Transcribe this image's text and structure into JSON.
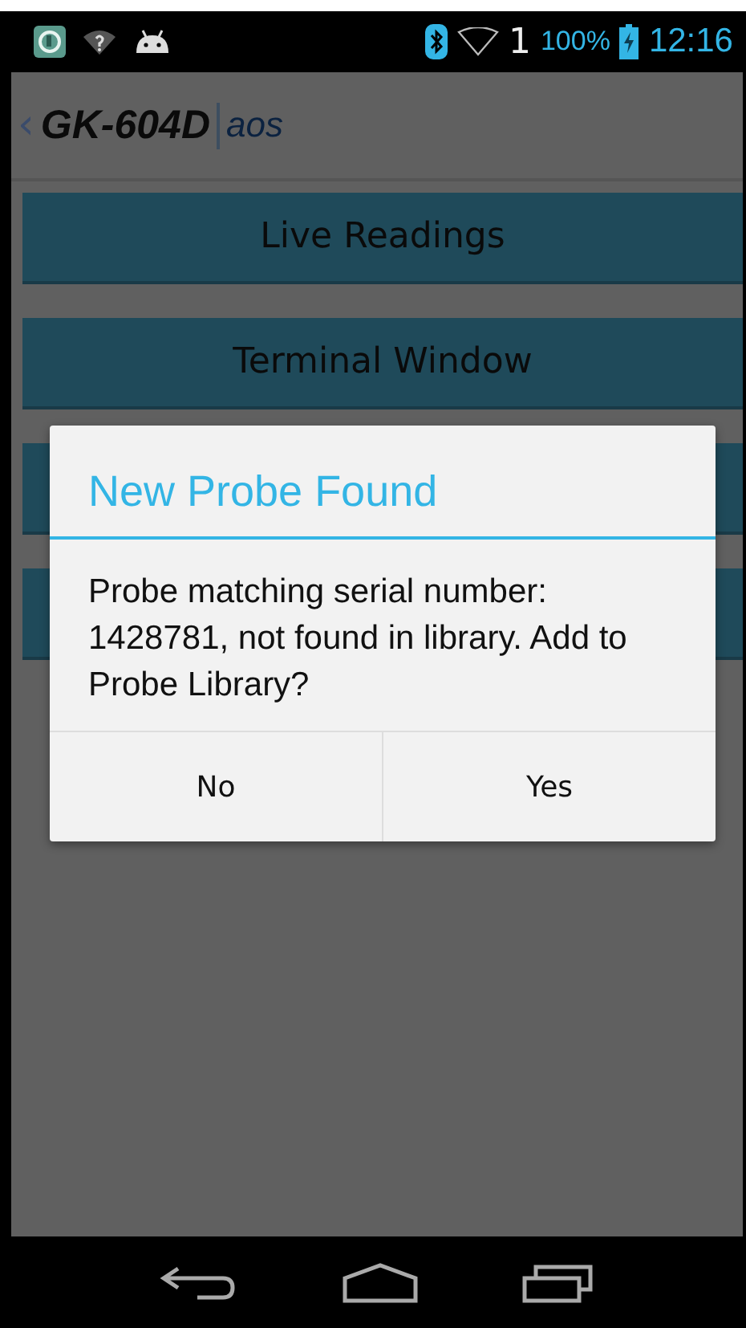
{
  "status_bar": {
    "signal_label": "1",
    "battery": "100%",
    "time": "12:16"
  },
  "action_bar": {
    "back": "‹",
    "title": "GK-604D",
    "subtitle": "aos"
  },
  "menu_buttons": [
    {
      "kind": "labeled",
      "label": "Live Readings"
    },
    {
      "kind": "labeled",
      "label": "Terminal Window"
    },
    {
      "kind": "covered"
    },
    {
      "kind": "covered"
    }
  ],
  "dialog": {
    "title": "New Probe Found",
    "message": "Probe matching serial number: 1428781, not found in library. Add to Probe Library?",
    "buttons": [
      "No",
      "Yes"
    ]
  }
}
